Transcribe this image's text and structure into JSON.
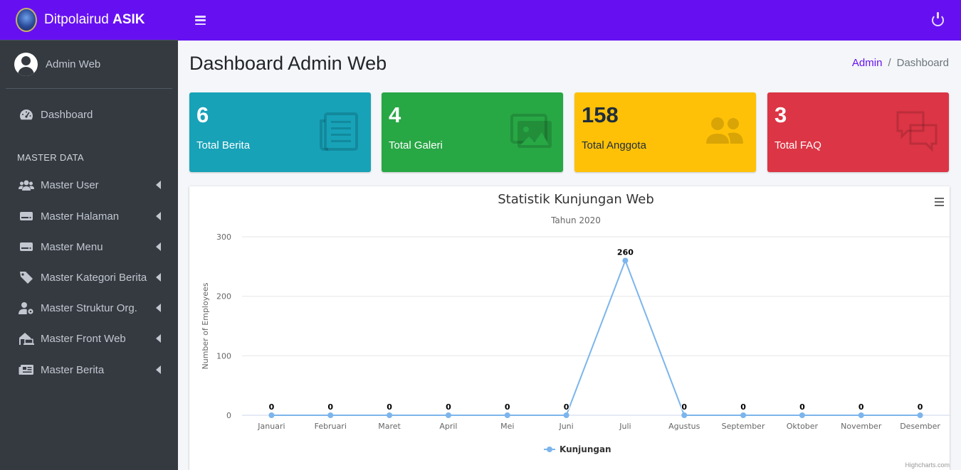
{
  "brand": {
    "name_regular": "Ditpolairud ",
    "name_bold": "ASIK",
    "logo_icon": "police-logo-icon"
  },
  "user": {
    "name": "Admin Web"
  },
  "sidebar": {
    "dashboard_label": "Dashboard",
    "section_header": "MASTER DATA",
    "items": [
      {
        "label": "Master User",
        "icon": "users-icon"
      },
      {
        "label": "Master Halaman",
        "icon": "hdd-icon"
      },
      {
        "label": "Master Menu",
        "icon": "hdd-icon"
      },
      {
        "label": "Master Kategori Berita",
        "icon": "tag-icon"
      },
      {
        "label": "Master Struktur Org.",
        "icon": "user-cog-icon"
      },
      {
        "label": "Master Front Web",
        "icon": "house-laptop-icon"
      },
      {
        "label": "Master Berita",
        "icon": "newspaper-icon"
      }
    ]
  },
  "header": {
    "title": "Dashboard Admin Web"
  },
  "breadcrumb": {
    "home": "Admin",
    "separator": "/",
    "current": "Dashboard"
  },
  "boxes": [
    {
      "value": "6",
      "label": "Total Berita",
      "icon": "newspaper-icon",
      "color": "#17a2b8"
    },
    {
      "value": "4",
      "label": "Total Galeri",
      "icon": "images-icon",
      "color": "#28a745"
    },
    {
      "value": "158",
      "label": "Total Anggota",
      "icon": "users-icon",
      "color": "#ffc107"
    },
    {
      "value": "3",
      "label": "Total FAQ",
      "icon": "comments-icon",
      "color": "#dc3545"
    }
  ],
  "colors": {
    "accent": "#6610f2",
    "sidebar": "#343a40",
    "series": "#7cb5ec"
  },
  "credit": "Highcharts.com",
  "chart_data": {
    "type": "line",
    "title": "Statistik Kunjungan Web",
    "subtitle": "Tahun 2020",
    "xlabel": "",
    "ylabel": "Number of Employees",
    "ylim": [
      0,
      300
    ],
    "yticks": [
      0,
      100,
      200,
      300
    ],
    "grid": true,
    "legend_position": "bottom-center",
    "categories": [
      "Januari",
      "Februari",
      "Maret",
      "April",
      "Mei",
      "Juni",
      "Juli",
      "Agustus",
      "September",
      "Oktober",
      "November",
      "Desember"
    ],
    "series": [
      {
        "name": "Kunjungan",
        "values": [
          0,
          0,
          0,
          0,
          0,
          0,
          260,
          0,
          0,
          0,
          0,
          0
        ]
      }
    ]
  }
}
